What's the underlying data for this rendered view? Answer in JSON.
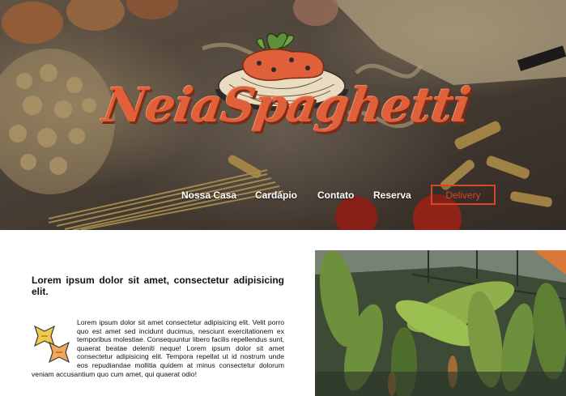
{
  "brand": {
    "logo_text": "NeiaSpaghetti",
    "accent_color": "#e0603a",
    "logo_icon": "spaghetti-bowl-icon"
  },
  "nav": {
    "items": [
      {
        "label": "Nossa Casa"
      },
      {
        "label": "Cardápio"
      },
      {
        "label": "Contato"
      },
      {
        "label": "Reserva"
      }
    ],
    "delivery_label": "Delivery",
    "delivery_color": "#d7462b"
  },
  "content": {
    "heading": "Lorem ipsum dolor sit amet, consectetur adipisicing elit.",
    "paragraph": "Lorem ipsum dolor sit amet consectetur adipisicing elit. Velit porro quo est amet sed incidunt ducimus, nesciunt exercitationem ex temporibus molestiae. Consequuntur libero facilis repellendus sunt, quaerat beatae deleniti neque! Lorem ipsum dolor sit amet consectetur adipisicing elit. Tempora repellat ut id nostrum unde eos repudiandae mollitia quidem at minus consectetur dolorum veniam accusantium quo cum amet, qui quaerat odio!",
    "pasta_icon": "farfalle-pasta-icon",
    "photo": "restaurant-plants-photo"
  }
}
